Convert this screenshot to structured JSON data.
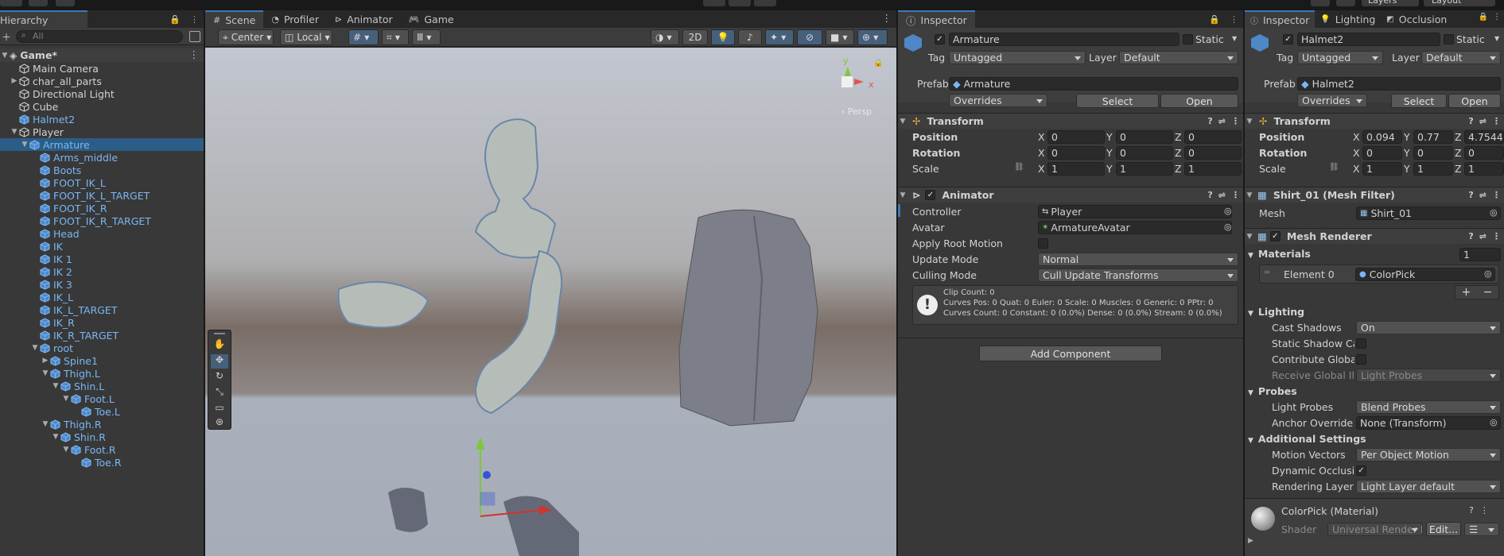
{
  "topbar": {
    "left_title": "",
    "play_controls": [
      "play-icon",
      "pause-icon",
      "step-icon"
    ],
    "layers_label": "Layers",
    "layout_label": "Layout"
  },
  "hierarchy": {
    "tab_label": "Hierarchy",
    "search_placeholder": "All",
    "scene_name": "Game*",
    "items": [
      {
        "label": "Main Camera",
        "depth": 1,
        "arrow": "",
        "prefab": false
      },
      {
        "label": "char_all_parts",
        "depth": 1,
        "arrow": "right",
        "prefab": false
      },
      {
        "label": "Directional Light",
        "depth": 1,
        "arrow": "",
        "prefab": false
      },
      {
        "label": "Cube",
        "depth": 1,
        "arrow": "",
        "prefab": false
      },
      {
        "label": "Halmet2",
        "depth": 1,
        "arrow": "",
        "prefab": true
      },
      {
        "label": "Player",
        "depth": 1,
        "arrow": "down",
        "prefab": false
      },
      {
        "label": "Armature",
        "depth": 2,
        "arrow": "down",
        "prefab": true,
        "selected": true
      },
      {
        "label": "Arms_middle",
        "depth": 3,
        "arrow": "",
        "prefab": true
      },
      {
        "label": "Boots",
        "depth": 3,
        "arrow": "",
        "prefab": true
      },
      {
        "label": "FOOT_IK_L",
        "depth": 3,
        "arrow": "",
        "prefab": true
      },
      {
        "label": "FOOT_IK_L_TARGET",
        "depth": 3,
        "arrow": "",
        "prefab": true
      },
      {
        "label": "FOOT_IK_R",
        "depth": 3,
        "arrow": "",
        "prefab": true
      },
      {
        "label": "FOOT_IK_R_TARGET",
        "depth": 3,
        "arrow": "",
        "prefab": true
      },
      {
        "label": "Head",
        "depth": 3,
        "arrow": "",
        "prefab": true
      },
      {
        "label": "IK",
        "depth": 3,
        "arrow": "",
        "prefab": true
      },
      {
        "label": "IK 1",
        "depth": 3,
        "arrow": "",
        "prefab": true
      },
      {
        "label": "IK 2",
        "depth": 3,
        "arrow": "",
        "prefab": true
      },
      {
        "label": "IK 3",
        "depth": 3,
        "arrow": "",
        "prefab": true
      },
      {
        "label": "IK_L",
        "depth": 3,
        "arrow": "",
        "prefab": true
      },
      {
        "label": "IK_L_TARGET",
        "depth": 3,
        "arrow": "",
        "prefab": true
      },
      {
        "label": "IK_R",
        "depth": 3,
        "arrow": "",
        "prefab": true
      },
      {
        "label": "IK_R_TARGET",
        "depth": 3,
        "arrow": "",
        "prefab": true
      },
      {
        "label": "root",
        "depth": 3,
        "arrow": "down",
        "prefab": true
      },
      {
        "label": "Spine1",
        "depth": 4,
        "arrow": "right",
        "prefab": true
      },
      {
        "label": "Thigh.L",
        "depth": 4,
        "arrow": "down",
        "prefab": true
      },
      {
        "label": "Shin.L",
        "depth": 5,
        "arrow": "down",
        "prefab": true
      },
      {
        "label": "Foot.L",
        "depth": 6,
        "arrow": "down",
        "prefab": true
      },
      {
        "label": "Toe.L",
        "depth": 7,
        "arrow": "",
        "prefab": true
      },
      {
        "label": "Thigh.R",
        "depth": 4,
        "arrow": "down",
        "prefab": true
      },
      {
        "label": "Shin.R",
        "depth": 5,
        "arrow": "down",
        "prefab": true
      },
      {
        "label": "Foot.R",
        "depth": 6,
        "arrow": "down",
        "prefab": true
      },
      {
        "label": "Toe.R",
        "depth": 7,
        "arrow": "",
        "prefab": true
      }
    ]
  },
  "scene": {
    "tabs": [
      {
        "label": "Scene",
        "icon": "grid-icon",
        "active": true
      },
      {
        "label": "Profiler",
        "icon": "profiler-icon",
        "active": false
      },
      {
        "label": "Animator",
        "icon": "animator-icon",
        "active": false
      },
      {
        "label": "Game",
        "icon": "gamepad-icon",
        "active": false
      }
    ],
    "pivot_label": "Center",
    "space_label": "Local",
    "mode_2d": "2D",
    "persp_label": "Persp",
    "gizmo_axes": [
      "y",
      "x"
    ]
  },
  "inspector1": {
    "tab_label": "Inspector",
    "object_name": "Armature",
    "static_label": "Static",
    "tag_label": "Tag",
    "tag_value": "Untagged",
    "layer_label": "Layer",
    "layer_value": "Default",
    "prefab_label": "Prefab",
    "prefab_value": "Armature",
    "overrides_label": "Overrides",
    "select_label": "Select",
    "open_label": "Open",
    "transform_title": "Transform",
    "position_label": "Position",
    "rotation_label": "Rotation",
    "scale_label": "Scale",
    "position": [
      "0",
      "0",
      "0"
    ],
    "rotation": [
      "0",
      "0",
      "0"
    ],
    "scale": [
      "1",
      "1",
      "1"
    ],
    "axis": [
      "X",
      "Y",
      "Z"
    ],
    "animator_title": "Animator",
    "controller_label": "Controller",
    "controller_value": "Player",
    "avatar_label": "Avatar",
    "avatar_value": "ArmatureAvatar",
    "apply_root_label": "Apply Root Motion",
    "update_mode_label": "Update Mode",
    "update_mode_value": "Normal",
    "culling_mode_label": "Culling Mode",
    "culling_mode_value": "Cull Update Transforms",
    "info_lines": [
      "Clip Count: 0",
      "Curves Pos: 0 Quat: 0 Euler: 0 Scale: 0 Muscles: 0 Generic: 0 PPtr: 0",
      "Curves Count: 0 Constant: 0 (0.0%) Dense: 0 (0.0%) Stream: 0 (0.0%)"
    ],
    "add_component_label": "Add Component"
  },
  "inspector2": {
    "tabs": [
      {
        "label": "Inspector",
        "icon": "info-icon"
      },
      {
        "label": "Lighting",
        "icon": "bulb-icon"
      },
      {
        "label": "Occlusion",
        "icon": "occlusion-icon"
      }
    ],
    "object_name": "Halmet2",
    "static_label": "Static",
    "tag_label": "Tag",
    "tag_value": "Untagged",
    "layer_label": "Layer",
    "layer_value": "Default",
    "prefab_label": "Prefab",
    "prefab_value": "Halmet2",
    "overrides_label": "Overrides",
    "select_label": "Select",
    "open_label": "Open",
    "transform_title": "Transform",
    "position_label": "Position",
    "rotation_label": "Rotation",
    "scale_label": "Scale",
    "position": [
      "0.094",
      "0.77",
      "4.7544"
    ],
    "rotation": [
      "0",
      "0",
      "0"
    ],
    "scale": [
      "1",
      "1",
      "1"
    ],
    "axis": [
      "X",
      "Y",
      "Z"
    ],
    "meshfilter_title": "Shirt_01 (Mesh Filter)",
    "mesh_label": "Mesh",
    "mesh_value": "Shirt_01",
    "renderer_title": "Mesh Renderer",
    "materials_label": "Materials",
    "materials_count": "1",
    "element0_label": "Element 0",
    "element0_value": "ColorPick",
    "plus_label": "+",
    "minus_label": "−",
    "lighting_label": "Lighting",
    "cast_shadows_label": "Cast Shadows",
    "cast_shadows_value": "On",
    "static_shadow_label": "Static Shadow Cas",
    "contribute_gi_label": "Contribute Global I",
    "receive_gi_label": "Receive Global Illu",
    "receive_gi_value": "Light Probes",
    "probes_label": "Probes",
    "light_probes_label": "Light Probes",
    "light_probes_value": "Blend Probes",
    "anchor_override_label": "Anchor Override",
    "anchor_override_value": "None (Transform)",
    "additional_label": "Additional Settings",
    "motion_vectors_label": "Motion Vectors",
    "motion_vectors_value": "Per Object Motion",
    "dynamic_occlusion_label": "Dynamic Occlusio",
    "rendering_layer_label": "Rendering Layer M",
    "rendering_layer_value": "Light Layer default",
    "material_title": "ColorPick (Material)",
    "shader_label": "Shader",
    "shader_value": "Universal Render P",
    "edit_label": "Edit...",
    "menu_label": "☰"
  },
  "colors": {
    "accent": "#3a79bb",
    "prefab_text": "#7ab7f4",
    "selection": "#2c5d87",
    "panel": "#383838"
  }
}
